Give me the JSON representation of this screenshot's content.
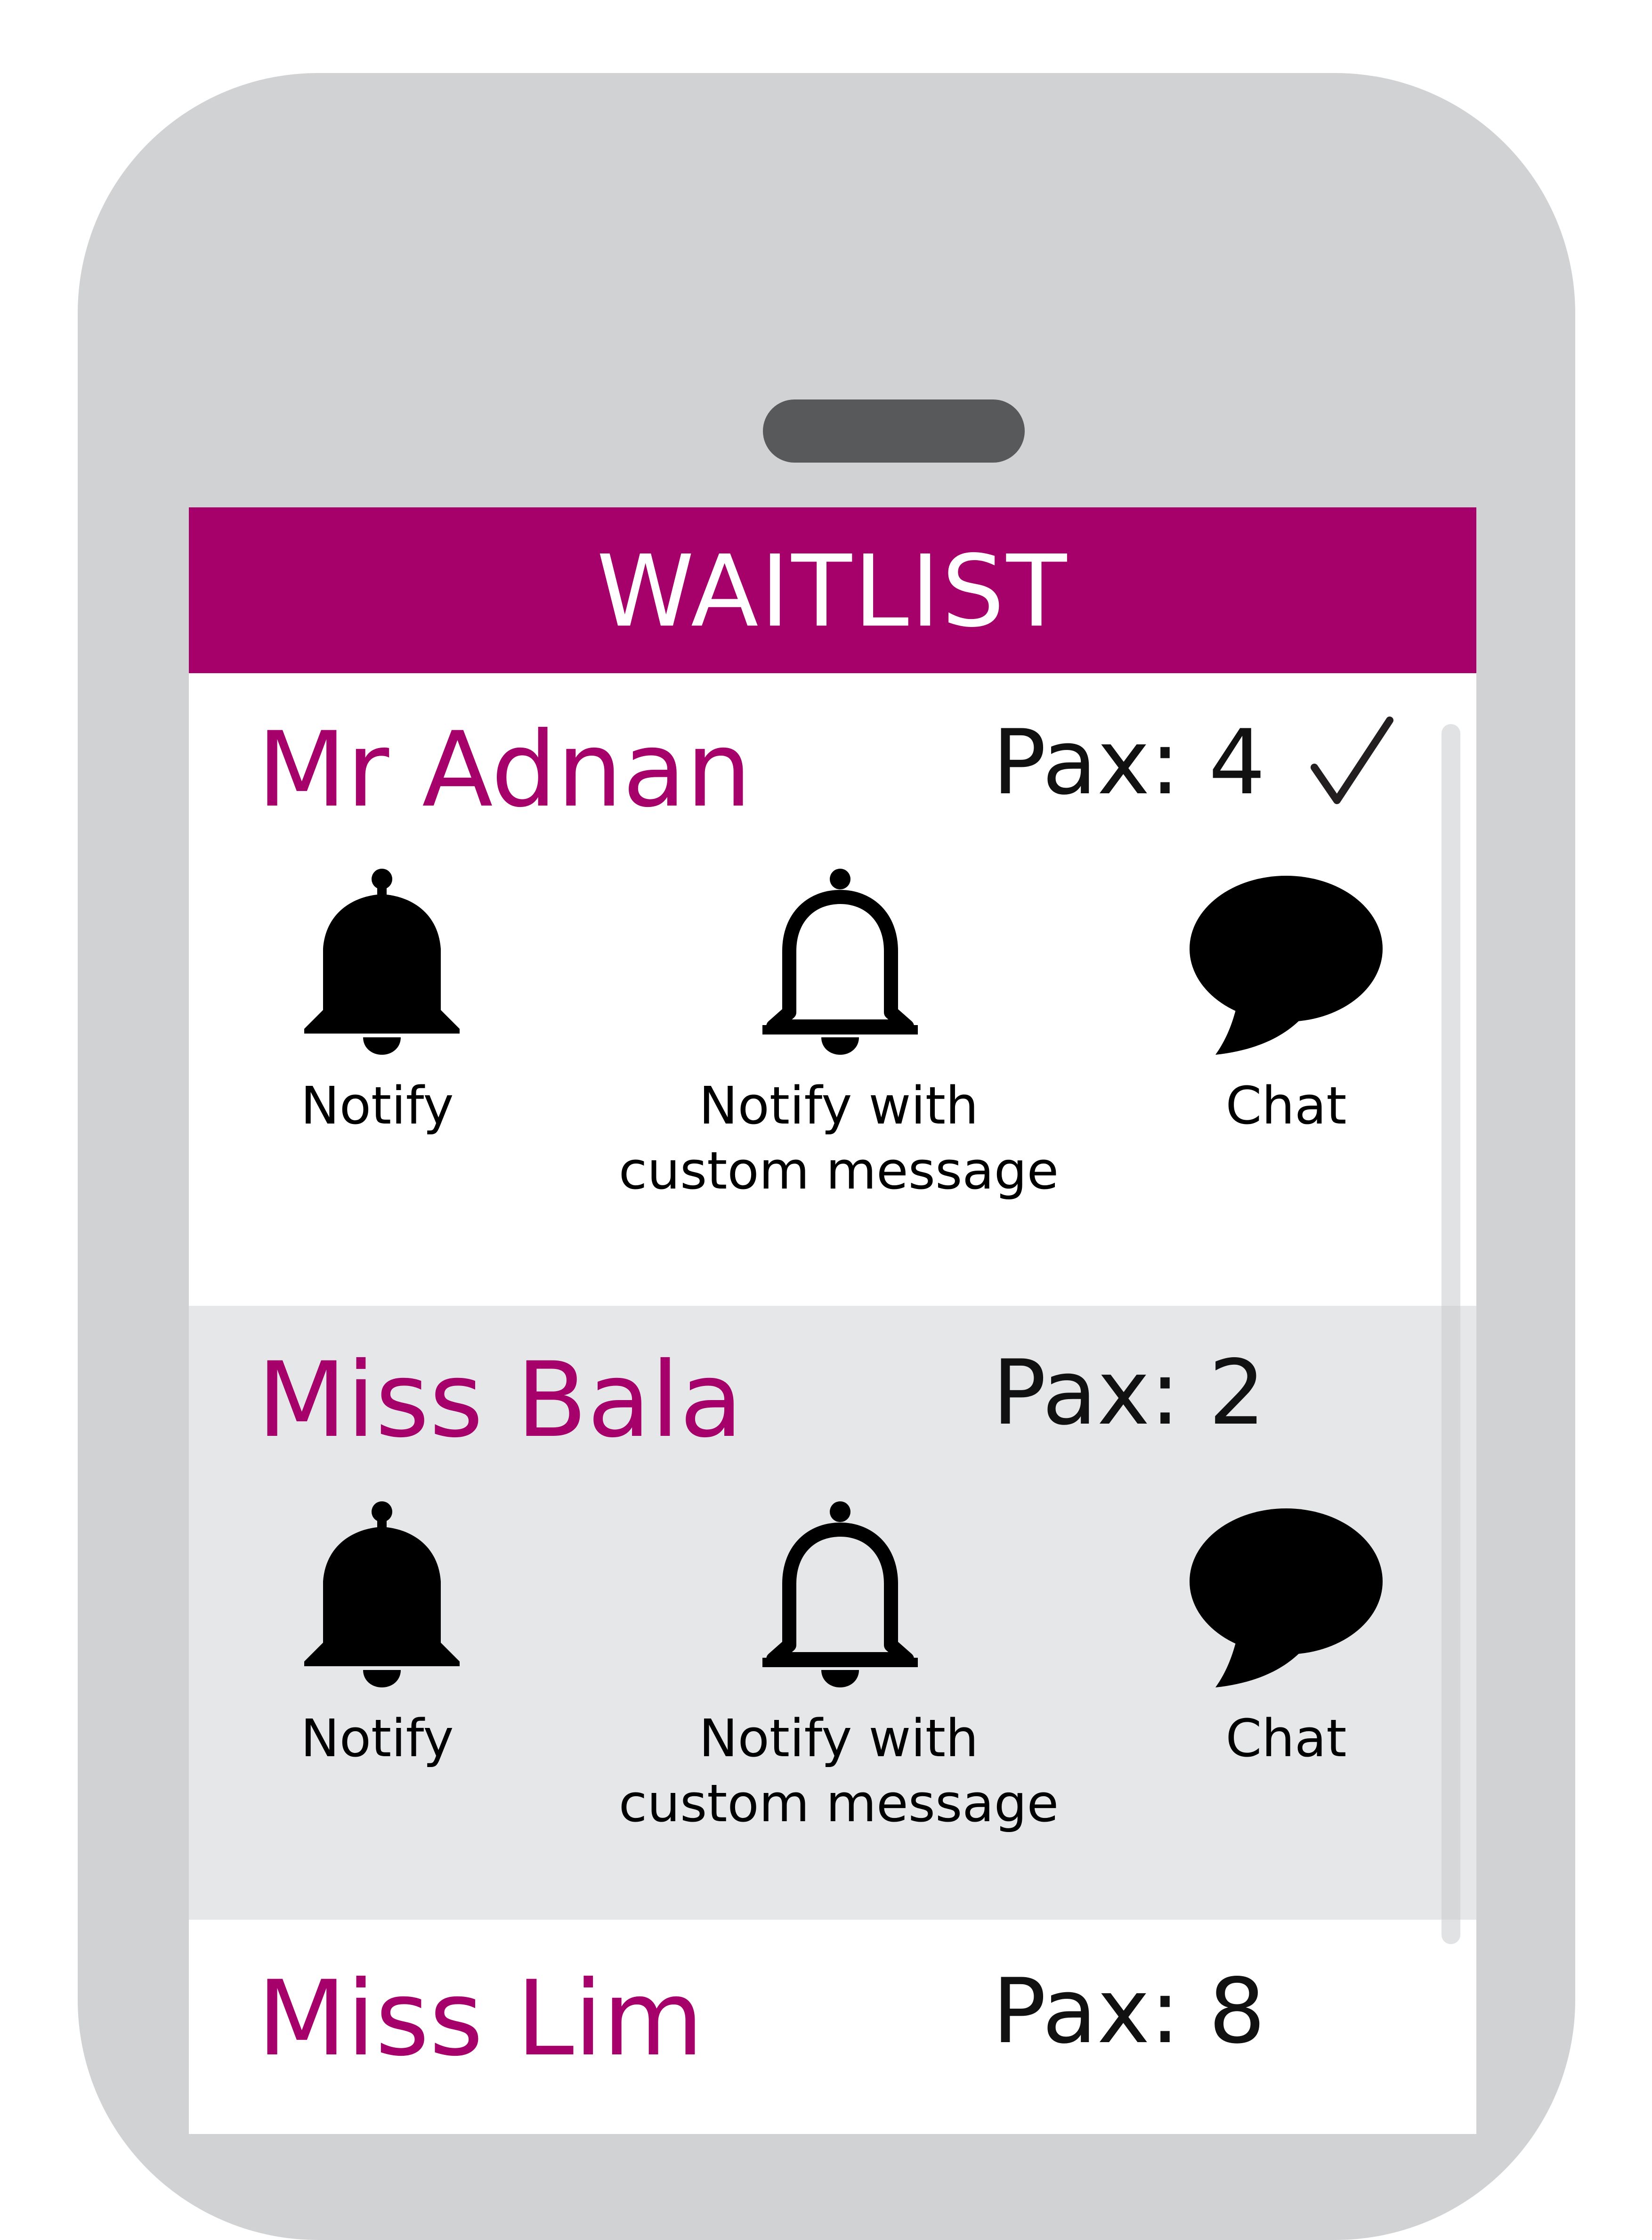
{
  "app": {
    "title": "WAITLIST"
  },
  "colors": {
    "brand": "#a6006a",
    "phone_body": "#d1d2d4",
    "speaker": "#58595b",
    "row_alt": "#e6e7e8"
  },
  "waitlist": [
    {
      "name": "Mr Adnan",
      "pax": "Pax: 4",
      "confirmed": true,
      "actions": {
        "notify_label": "Notify",
        "notify_custom_label_line1": "Notify with",
        "notify_custom_label_line2": "custom message",
        "chat_label": "Chat"
      },
      "icons": [
        "bell-filled-icon",
        "bell-outline-icon",
        "chat-bubble-icon",
        "checkmark-icon"
      ]
    },
    {
      "name": "Miss Bala",
      "pax": "Pax: 2",
      "confirmed": false,
      "actions": {
        "notify_label": "Notify",
        "notify_custom_label_line1": "Notify with",
        "notify_custom_label_line2": "custom message",
        "chat_label": "Chat"
      },
      "icons": [
        "bell-filled-icon",
        "bell-outline-icon",
        "chat-bubble-icon"
      ]
    },
    {
      "name": "Miss Lim",
      "pax": "Pax: 8",
      "confirmed": false
    }
  ]
}
